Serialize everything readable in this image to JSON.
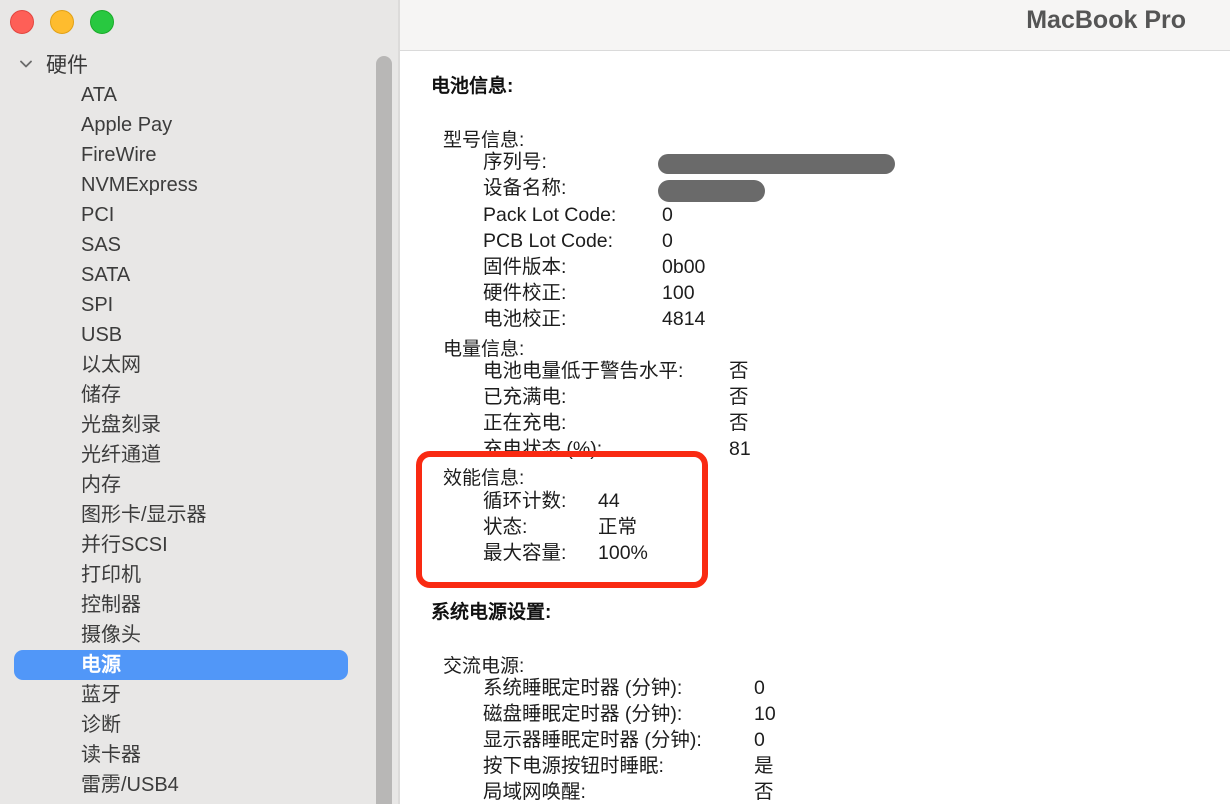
{
  "window": {
    "title": "MacBook Pro",
    "controls": [
      "close",
      "minimize",
      "zoom"
    ]
  },
  "sidebar": {
    "group_label": "硬件",
    "group_icon": "chevron-down-icon",
    "items": [
      {
        "label": "ATA"
      },
      {
        "label": "Apple Pay"
      },
      {
        "label": "FireWire"
      },
      {
        "label": "NVMExpress"
      },
      {
        "label": "PCI"
      },
      {
        "label": "SAS"
      },
      {
        "label": "SATA"
      },
      {
        "label": "SPI"
      },
      {
        "label": "USB"
      },
      {
        "label": "以太网"
      },
      {
        "label": "储存"
      },
      {
        "label": "光盘刻录"
      },
      {
        "label": "光纤通道"
      },
      {
        "label": "内存"
      },
      {
        "label": "图形卡/显示器"
      },
      {
        "label": "并行SCSI"
      },
      {
        "label": "打印机"
      },
      {
        "label": "控制器"
      },
      {
        "label": "摄像头"
      },
      {
        "label": "电源",
        "selected": true
      },
      {
        "label": "蓝牙"
      },
      {
        "label": "诊断"
      },
      {
        "label": "读卡器"
      },
      {
        "label": "雷雳/USB4"
      }
    ],
    "selection_color": "#5197f8"
  },
  "content": {
    "battery_info": {
      "title": "电池信息:",
      "model_info": {
        "title": "型号信息:",
        "rows": [
          {
            "key": "序列号:",
            "value": "",
            "redacted": true
          },
          {
            "key": "设备名称:",
            "value": "",
            "redacted": true
          },
          {
            "key": "Pack Lot Code:",
            "value": "0"
          },
          {
            "key": "PCB Lot Code:",
            "value": "0"
          },
          {
            "key": "固件版本:",
            "value": "0b00"
          },
          {
            "key": "硬件校正:",
            "value": "100"
          },
          {
            "key": "电池校正:",
            "value": "4814"
          }
        ]
      },
      "charge_info": {
        "title": "电量信息:",
        "rows": [
          {
            "key": "电池电量低于警告水平:",
            "value": "否"
          },
          {
            "key": "已充满电:",
            "value": "否"
          },
          {
            "key": "正在充电:",
            "value": "否"
          },
          {
            "key": "充电状态 (%):",
            "value": "81"
          }
        ]
      },
      "health_info": {
        "title": "效能信息:",
        "rows": [
          {
            "key": "循环计数:",
            "value": "44"
          },
          {
            "key": "状态:",
            "value": "正常"
          },
          {
            "key": "最大容量:",
            "value": "100%"
          }
        ],
        "highlight_color": "#f92a12"
      }
    },
    "power_settings": {
      "title": "系统电源设置:",
      "ac_power": {
        "title": "交流电源:",
        "rows": [
          {
            "key": "系统睡眠定时器 (分钟):",
            "value": "0"
          },
          {
            "key": "磁盘睡眠定时器 (分钟):",
            "value": "10"
          },
          {
            "key": "显示器睡眠定时器 (分钟):",
            "value": "0"
          },
          {
            "key": "按下电源按钮时睡眠:",
            "value": "是"
          },
          {
            "key": "局域网唤醒:",
            "value": "否"
          }
        ]
      }
    }
  }
}
